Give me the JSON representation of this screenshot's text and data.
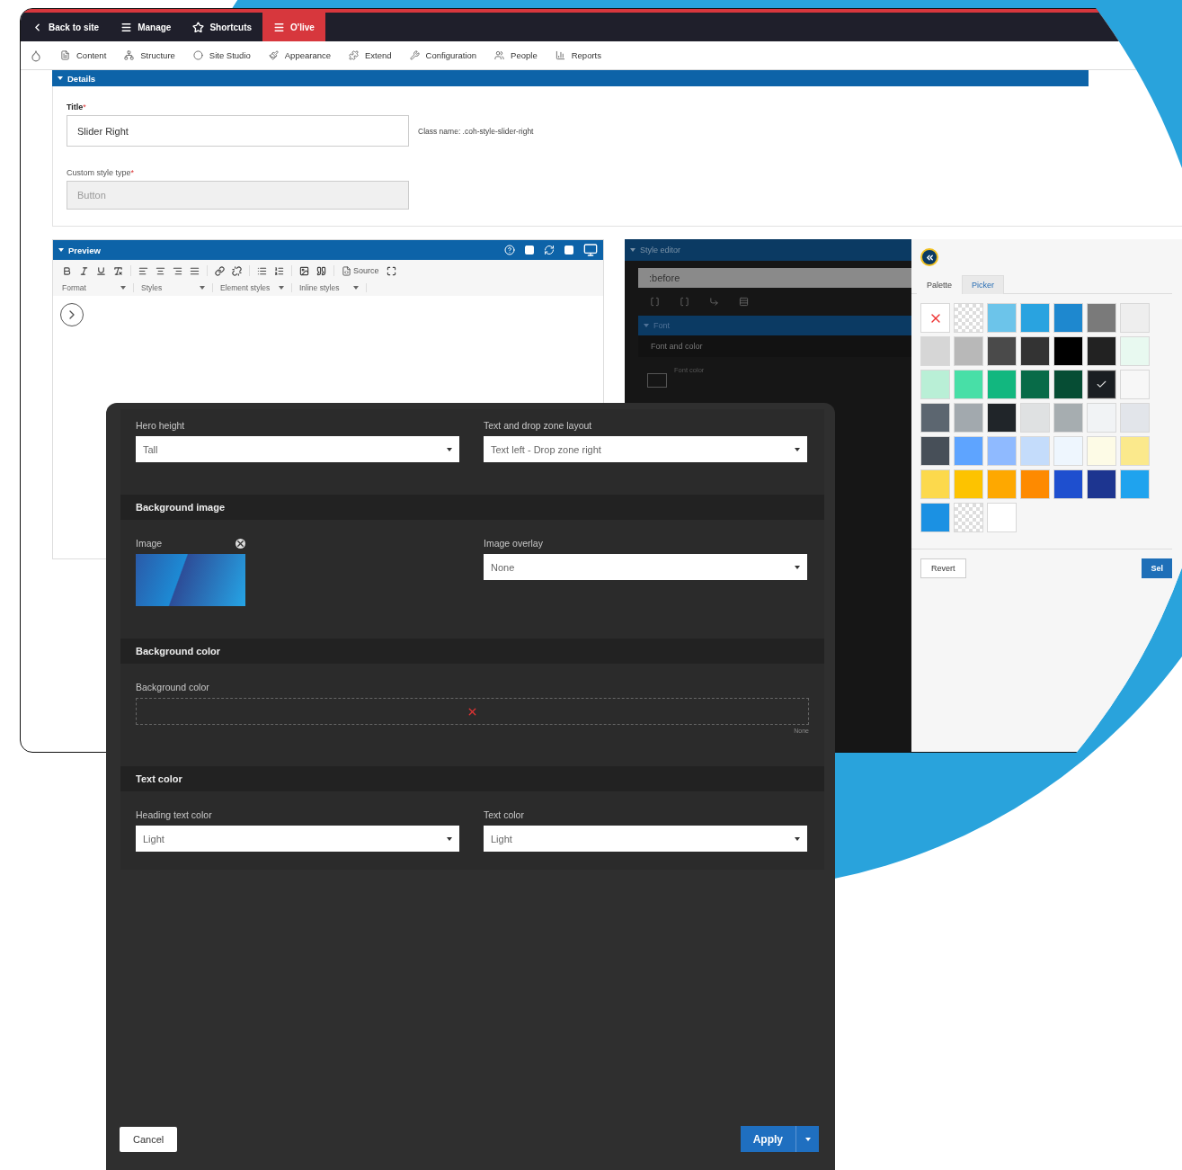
{
  "toolbar": {
    "items": [
      {
        "label": "Back to site",
        "kind": "link"
      },
      {
        "label": "Manage",
        "kind": "link"
      },
      {
        "label": "Shortcuts",
        "kind": "link"
      },
      {
        "label": "O'live",
        "kind": "environment"
      }
    ]
  },
  "admin_menu": {
    "items": [
      "Content",
      "Structure",
      "Site Studio",
      "Appearance",
      "Extend",
      "Configuration",
      "People",
      "Reports"
    ]
  },
  "details": {
    "heading": "Details",
    "title_label": "Title",
    "required_mark": "*",
    "title_value": "Slider Right",
    "class_name": "Class name: .coh-style-slider-right",
    "type_label": "Custom style type",
    "type_value": "Button"
  },
  "preview": {
    "heading": "Preview",
    "source_button": "Source",
    "dropdowns": [
      "Format",
      "Styles",
      "Element styles",
      "Inline styles"
    ]
  },
  "style_editor": {
    "heading": "Style editor",
    "selector": ":before",
    "section": "Font",
    "group": "Font and color",
    "field_label": "Font color"
  },
  "palette": {
    "tabs": [
      {
        "label": "Palette",
        "selected": true
      },
      {
        "label": "Picker",
        "selected": false
      }
    ],
    "swatches": [
      {
        "kind": "none",
        "selected": false
      },
      {
        "kind": "transparent",
        "selected": false
      },
      {
        "kind": "color",
        "color": "#6cc4ea",
        "selected": false
      },
      {
        "kind": "color",
        "color": "#29a3e0",
        "selected": false
      },
      {
        "kind": "color",
        "color": "#1e88cf",
        "selected": false
      },
      {
        "kind": "color",
        "color": "#7a7a7a",
        "selected": false
      },
      {
        "kind": "color",
        "color": "#eeeeee",
        "selected": false
      },
      {
        "kind": "color",
        "color": "#d6d6d6",
        "selected": false
      },
      {
        "kind": "color",
        "color": "#b8b8b8",
        "selected": false
      },
      {
        "kind": "color",
        "color": "#4a4a4a",
        "selected": false
      },
      {
        "kind": "color",
        "color": "#333333",
        "selected": false
      },
      {
        "kind": "color",
        "color": "#000000",
        "selected": false
      },
      {
        "kind": "color",
        "color": "#222222",
        "selected": false
      },
      {
        "kind": "color",
        "color": "#e8f9f0",
        "selected": false
      },
      {
        "kind": "color",
        "color": "#b9efd6",
        "selected": false
      },
      {
        "kind": "color",
        "color": "#48dfa7",
        "selected": false
      },
      {
        "kind": "color",
        "color": "#12b77f",
        "selected": false
      },
      {
        "kind": "color",
        "color": "#086b48",
        "selected": false
      },
      {
        "kind": "color",
        "color": "#064d34",
        "selected": false
      },
      {
        "kind": "color",
        "color": "#1a1e22",
        "selected": true
      },
      {
        "kind": "color",
        "color": "#f7f7f7",
        "selected": false
      },
      {
        "kind": "color",
        "color": "#5c6670",
        "selected": false
      },
      {
        "kind": "color",
        "color": "#a2a9ae",
        "selected": false
      },
      {
        "kind": "color",
        "color": "#202529",
        "selected": false
      },
      {
        "kind": "color",
        "color": "#dfe1e2",
        "selected": false
      },
      {
        "kind": "color",
        "color": "#a6adb0",
        "selected": false
      },
      {
        "kind": "color",
        "color": "#f1f3f5",
        "selected": false
      },
      {
        "kind": "color",
        "color": "#e2e5ea",
        "selected": false
      },
      {
        "kind": "color",
        "color": "#474f58",
        "selected": false
      },
      {
        "kind": "color",
        "color": "#5ea4ff",
        "selected": false
      },
      {
        "kind": "color",
        "color": "#8fbaff",
        "selected": false
      },
      {
        "kind": "color",
        "color": "#c4dcfb",
        "selected": false
      },
      {
        "kind": "color",
        "color": "#eef6fe",
        "selected": false
      },
      {
        "kind": "color",
        "color": "#fdfbe6",
        "selected": false
      },
      {
        "kind": "color",
        "color": "#fbe98c",
        "selected": false
      },
      {
        "kind": "color",
        "color": "#fcd94c",
        "selected": false
      },
      {
        "kind": "color",
        "color": "#fdc300",
        "selected": false
      },
      {
        "kind": "color",
        "color": "#fea800",
        "selected": false
      },
      {
        "kind": "color",
        "color": "#fe8a00",
        "selected": false
      },
      {
        "kind": "color",
        "color": "#1e4fcf",
        "selected": false
      },
      {
        "kind": "color",
        "color": "#1d3590",
        "selected": false
      },
      {
        "kind": "color",
        "color": "#1fa3ee",
        "selected": false
      },
      {
        "kind": "color",
        "color": "#1b91e3",
        "selected": false
      },
      {
        "kind": "transparent",
        "selected": false
      },
      {
        "kind": "color",
        "color": "#ffffff",
        "selected": false
      }
    ],
    "revert": "Revert",
    "select": "Sel"
  },
  "dialog": {
    "top_fields": [
      {
        "label": "Hero height",
        "value": "Tall"
      },
      {
        "label": "Text and drop zone layout",
        "value": "Text left - Drop zone right"
      }
    ],
    "sections": [
      {
        "kind": "image",
        "title": "Background image",
        "image_label": "Image",
        "overlay": {
          "label": "Image overlay",
          "value": "None"
        }
      },
      {
        "kind": "color",
        "title": "Background color",
        "field_label": "Background color",
        "note": "None"
      },
      {
        "kind": "selects",
        "title": "Text color",
        "fields": [
          {
            "label": "Heading text color",
            "value": "Light"
          },
          {
            "label": "Text color",
            "value": "Light"
          }
        ]
      }
    ],
    "cancel": "Cancel",
    "apply": "Apply"
  }
}
